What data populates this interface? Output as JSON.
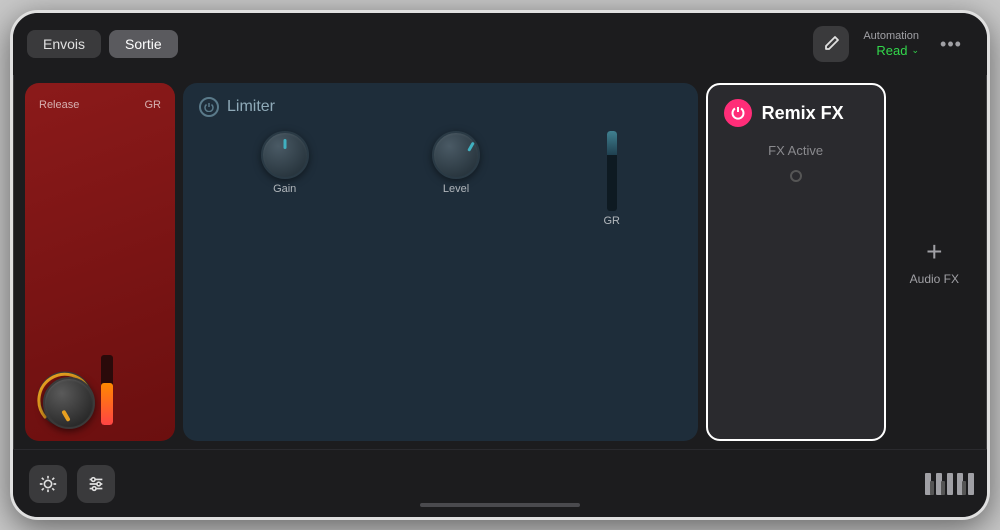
{
  "tabs": {
    "envois": "Envois",
    "sortie": "Sortie"
  },
  "header": {
    "automation_label": "Automation",
    "automation_value": "Read",
    "pencil_icon": "pencil-icon",
    "more_icon": "more-icon"
  },
  "plugins": {
    "red": {
      "release_label": "Release",
      "gr_label": "GR"
    },
    "limiter": {
      "name": "Limiter",
      "gain_label": "Gain",
      "level_label": "Level",
      "gr_label": "GR"
    },
    "remix": {
      "name": "Remix FX",
      "fx_active_label": "FX Active"
    },
    "add_fx": {
      "label": "Audio FX",
      "plus": "+"
    }
  },
  "bottom": {
    "scroll_hint": ""
  }
}
